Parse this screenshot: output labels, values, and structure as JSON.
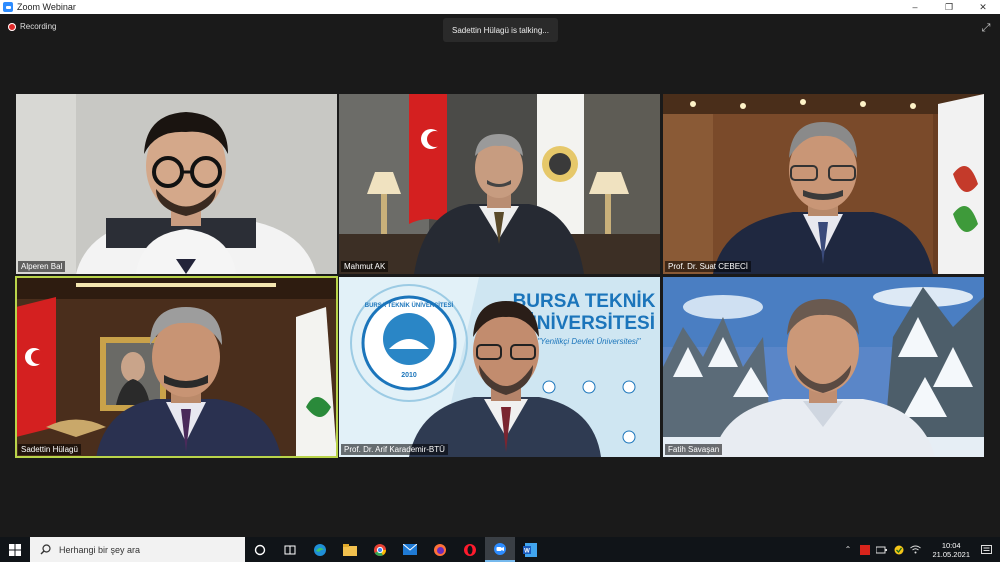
{
  "window": {
    "title": "Zoom Webinar",
    "controls": [
      "–",
      "❐",
      "✕"
    ]
  },
  "meeting": {
    "recording_label": "Recording",
    "talking_label": "Sadettin Hülagü is talking...",
    "active_speaker": "Sadettin Hülagü"
  },
  "participants": [
    {
      "name": "Alperen Bal",
      "bg": "#c8c8c4"
    },
    {
      "name": "Mahmut AK",
      "bg": "#4b4b48"
    },
    {
      "name": "Prof. Dr. Suat CEBECİ",
      "bg": "#7a4a2a"
    },
    {
      "name": "Sadettin Hülagü",
      "bg": "#4a2e1c"
    },
    {
      "name": "Prof. Dr. Arif Karademir-BTÜ",
      "bg": "#cfe6f2"
    },
    {
      "name": "Fatih Savaşan",
      "bg": "#5a86c8"
    }
  ],
  "backdrop": {
    "title_line1": "BURSA TEKNİK",
    "title_line2": "ÜNİVERSİTESİ",
    "tagline": "\"Yenilikçi Devlet Üniversitesi\"",
    "seal_ring": "BURSA TEKNİK ÜNİVERSİTESİ",
    "seal_year": "2010"
  },
  "taskbar": {
    "search_placeholder": "Herhangi bir şey ara",
    "time": "10:04",
    "date": "21.05.2021",
    "pinned": [
      "cortana-icon",
      "task-view-icon",
      "edge-icon",
      "file-explorer-icon",
      "chrome-icon",
      "mail-icon",
      "firefox-icon",
      "opera-icon",
      "zoom-icon",
      "word-icon"
    ]
  },
  "colors": {
    "accent_active": "#b9d44a",
    "zoom_blue": "#2d8cff",
    "btu_blue": "#1b75bb"
  }
}
